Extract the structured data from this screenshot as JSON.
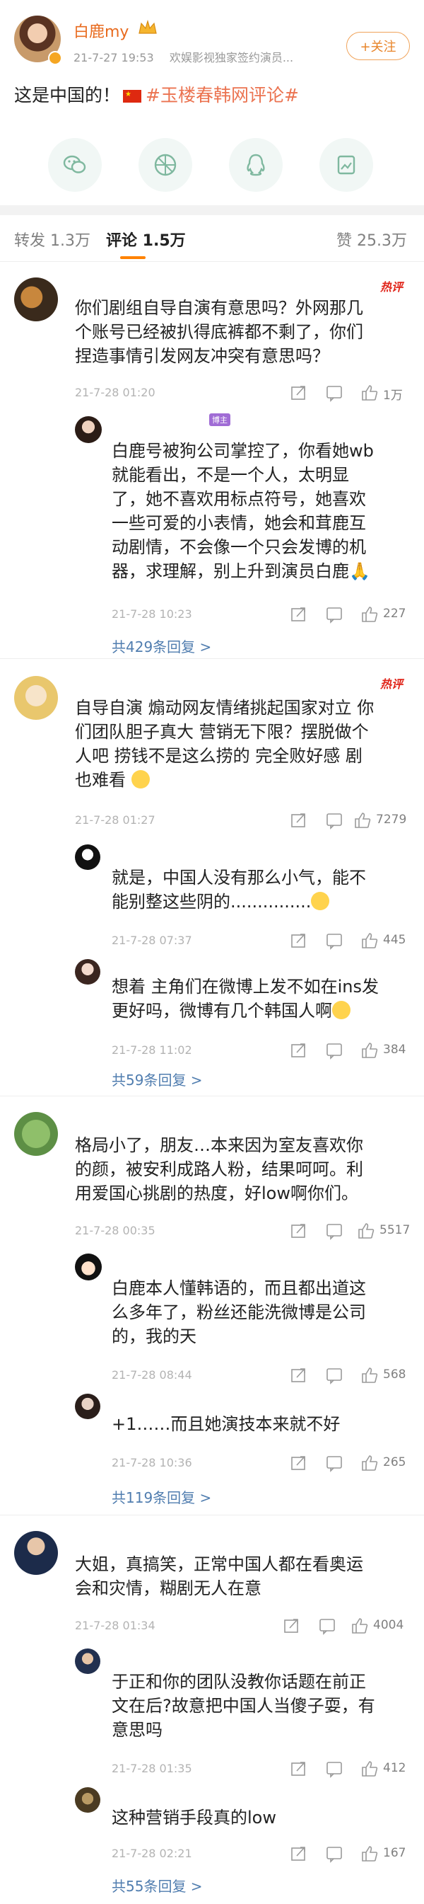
{
  "post": {
    "author": "白鹿my",
    "time": "21-7-27 19:53",
    "source": "欢娱影视独家签约演员...",
    "follow_label": "+关注",
    "text_prefix": "这是中国的！",
    "topic": "#玉楼春韩网评论#",
    "share_icons": [
      "wechat-icon",
      "moments-icon",
      "qq-icon",
      "save-image-icon"
    ]
  },
  "tabs": {
    "repost": "转发 1.3万",
    "comment": "评论 1.5万",
    "like": "赞 25.3万"
  },
  "threads": [
    {
      "hot_label": "热评",
      "text_lines": [
        "你们剧组自导自演有意思吗？外网那几",
        "个账号已经被扒得底裤都不剩了，你们",
        "捏造事情引发网友冲突有意思吗？"
      ],
      "time": "21-7-28 01:20",
      "likes": "1万",
      "replies": [
        {
          "author_badge": "博主",
          "text_lines": [
            "白鹿号被狗公司掌控了，你看她wb",
            "就能看出，不是一个人，太明显",
            "了，她不喜欢用标点符号，她喜欢",
            "一些可爱的小表情，她会和茸鹿互",
            "动剧情，不会像一个只会发博的机",
            "器，求理解，别上升到演员白鹿🙏"
          ],
          "time": "21-7-28 10:23",
          "likes": "227"
        }
      ],
      "more_replies": "共429条回复 >"
    },
    {
      "hot_label": "热评",
      "text_lines": [
        "自导自演 煽动网友情绪挑起国家对立 你",
        "们团队胆子真大 营销无下限？摆脱做个",
        "人吧 捞钱不是这么捞的 完全败好感 剧",
        "也难看"
      ],
      "time": "21-7-28 01:27",
      "likes": "7279",
      "replies": [
        {
          "text_lines": [
            "就是，中国人没有那么小气，能不",
            "能别整这些阴的..............."
          ],
          "time": "21-7-28 07:37",
          "likes": "445"
        },
        {
          "text_lines": [
            "想着 主角们在微博上发不如在ins发",
            "更好吗，微博有几个韩国人啊"
          ],
          "time": "21-7-28 11:02",
          "likes": "384"
        }
      ],
      "more_replies": "共59条回复 >"
    },
    {
      "text_lines": [
        "格局小了，朋友…本来因为室友喜欢你",
        "的颜，被安利成路人粉，结果呵呵。利",
        "用爱国心挑剧的热度，好low啊你们。"
      ],
      "time": "21-7-28 00:35",
      "likes": "5517",
      "replies": [
        {
          "text_lines": [
            "白鹿本人懂韩语的，而且都出道这",
            "么多年了，粉丝还能洗微博是公司",
            "的，我的天"
          ],
          "time": "21-7-28 08:44",
          "likes": "568"
        },
        {
          "text_lines": [
            "+1……而且她演技本来就不好"
          ],
          "time": "21-7-28 10:36",
          "likes": "265"
        }
      ],
      "more_replies": "共119条回复 >"
    },
    {
      "text_lines": [
        "大姐，真搞笑，正常中国人都在看奥运",
        "会和灾情，糊剧无人在意"
      ],
      "time": "21-7-28 01:34",
      "likes": "4004",
      "replies": [
        {
          "text_lines": [
            "于正和你的团队没教你话题在前正",
            "文在后?故意把中国人当傻子耍，有",
            "意思吗"
          ],
          "time": "21-7-28 01:35",
          "likes": "412"
        },
        {
          "text_lines": [
            "这种营销手段真的low"
          ],
          "time": "21-7-28 02:21",
          "likes": "167"
        }
      ],
      "more_replies": "共55条回复 >"
    }
  ],
  "colors": {
    "accent": "#ff8200",
    "link": "#507daf",
    "topic": "#eb7350",
    "hot": "#e0261b"
  }
}
